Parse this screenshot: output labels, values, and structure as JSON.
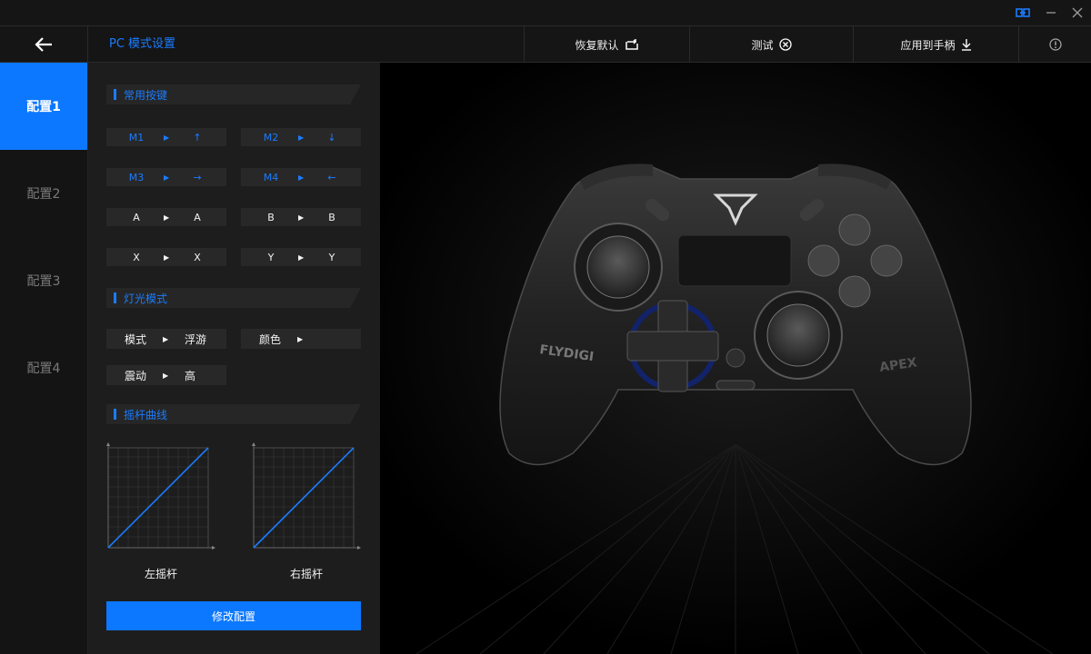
{
  "window": {
    "controls": [
      {
        "name": "link-icon"
      },
      {
        "name": "minimize-icon"
      },
      {
        "name": "close-icon"
      }
    ]
  },
  "header": {
    "title": "PC 模式设置",
    "restore_label": "恢复默认",
    "test_label": "测试",
    "apply_label": "应用到手柄"
  },
  "tabs": [
    "配置1",
    "配置2",
    "配置3",
    "配置4"
  ],
  "active_tab": "配置1",
  "common_keys": {
    "title": "常用按键",
    "rows": [
      {
        "from": "M1",
        "to": "↑"
      },
      {
        "from": "M2",
        "to": "↓"
      },
      {
        "from": "M3",
        "to": "→"
      },
      {
        "from": "M4",
        "to": "←"
      },
      {
        "from": "A",
        "to": "A"
      },
      {
        "from": "B",
        "to": "B"
      },
      {
        "from": "X",
        "to": "X"
      },
      {
        "from": "Y",
        "to": "Y"
      }
    ]
  },
  "light": {
    "title": "灯光模式",
    "mode_label": "模式",
    "mode_value": "浮游",
    "color_label": "颜色",
    "vibration_label": "震动",
    "vibration_value": "高"
  },
  "stick": {
    "title": "摇杆曲线",
    "left_label": "左摇杆",
    "right_label": "右摇杆"
  },
  "modify_label": "修改配置",
  "colors": {
    "accent": "#0c78ff",
    "accent_text": "#1a7cff",
    "panel": "#1d1d1d",
    "row": "#282828"
  },
  "controller": {
    "brand_text": "FLYDIGI",
    "model_text": "APEX"
  }
}
